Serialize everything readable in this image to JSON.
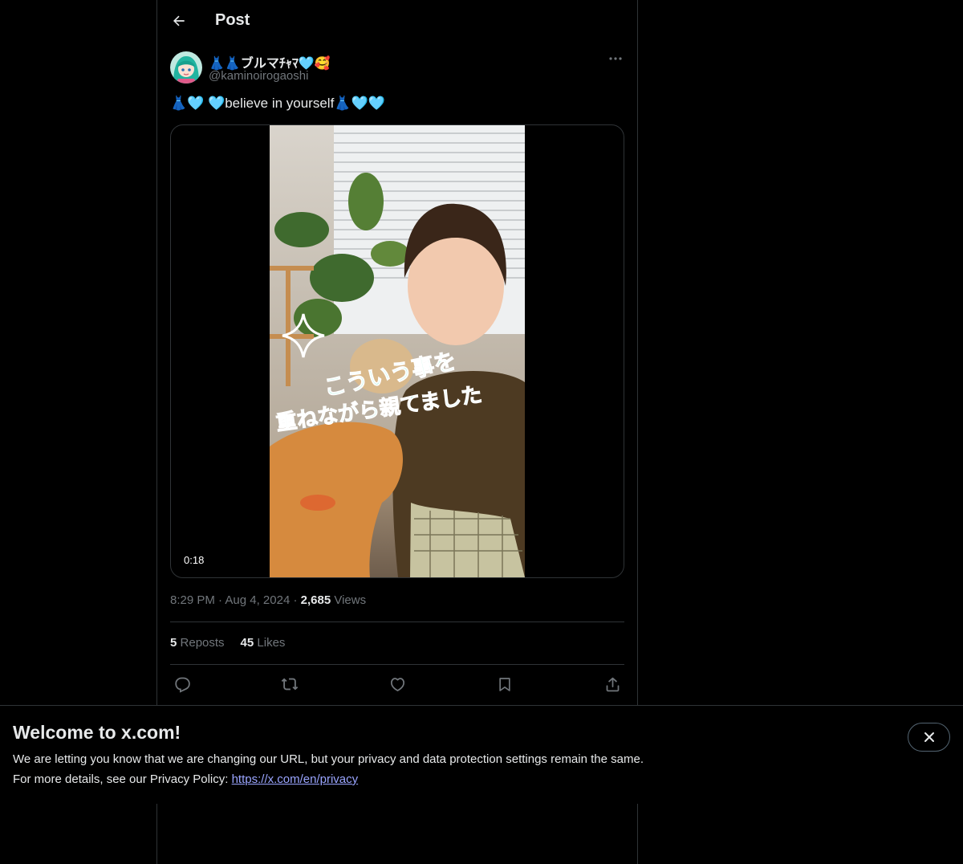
{
  "header": {
    "title": "Post"
  },
  "author": {
    "display_name": "👗👗ブルマﾁｬﾏ🩵🥰",
    "handle": "@kaminoirogaoshi"
  },
  "post": {
    "text": "👗🩵 🩵believe in yourself👗🩵🩵",
    "video": {
      "duration": "0:18",
      "caption_line1": "こういう事を",
      "caption_line2": "重ねながら親てました"
    },
    "time": "8:29 PM",
    "date": "Aug 4, 2024",
    "separator": "·",
    "views_count": "2,685",
    "views_label": "Views",
    "reposts_count": "5",
    "reposts_label": "Reposts",
    "likes_count": "45",
    "likes_label": "Likes"
  },
  "actions": [
    "reply-icon",
    "repost-icon",
    "like-icon",
    "bookmark-icon",
    "share-icon"
  ],
  "banner": {
    "title": "Welcome to x.com!",
    "line1": "We are letting you know that we are changing our URL, but your privacy and data protection settings remain the same.",
    "line2_prefix": "For more details, see our Privacy Policy: ",
    "link": "https://x.com/en/privacy"
  },
  "colors": {
    "background": "#000000",
    "text_primary": "#e7e9ea",
    "text_secondary": "#71767b",
    "border": "#2f3336",
    "link": "#9aa5ff"
  }
}
